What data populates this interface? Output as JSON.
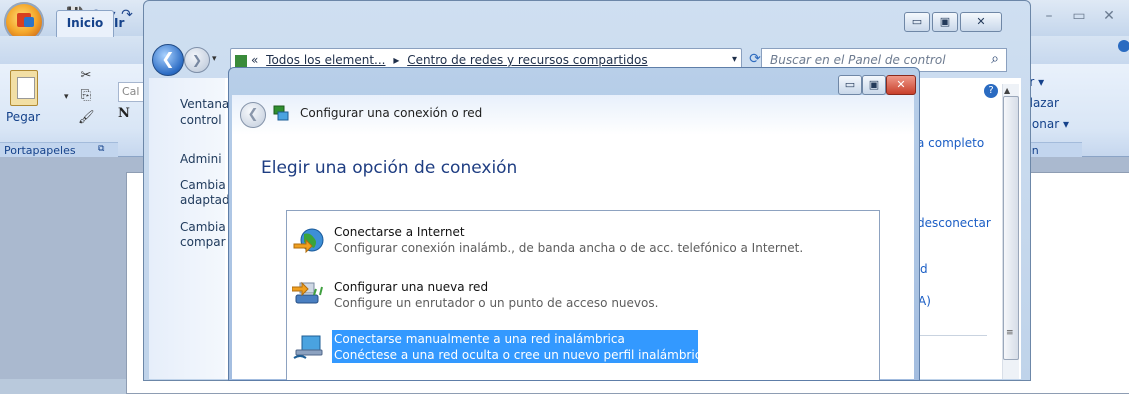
{
  "word": {
    "tabs": [
      "Inicio",
      "Ir"
    ],
    "clipboard": {
      "paste_label": "Pegar",
      "group_label": "Portapapeles"
    },
    "font_name": "Cal",
    "bold_label": "N",
    "right_ribbon_items": [
      "ar ▾",
      "plazar",
      "cionar ▾"
    ],
    "right_group_label": "ión",
    "controls": {
      "minimize": "–",
      "restore": "▭",
      "close": "✕"
    }
  },
  "control_panel": {
    "breadcrumb": [
      "«",
      "Todos los element...",
      "▸",
      "Centro de redes y recursos compartidos"
    ],
    "search_placeholder": "Buscar en el Panel de control",
    "left_links": [
      "Ventana",
      "control",
      "Admini",
      "Cambia",
      "adaptad",
      "Cambia",
      "compar"
    ],
    "right_links": [
      "a completo",
      "desconectar",
      "d",
      "A)"
    ],
    "controls": {
      "minimize": "▭",
      "restore": "▣",
      "close": "✕"
    }
  },
  "dialog": {
    "title": "Configurar una conexión o red",
    "heading": "Elegir una opción de conexión",
    "controls": {
      "minimize": "▭",
      "restore": "▣",
      "close": "✕"
    },
    "options": [
      {
        "title": "Conectarse a Internet",
        "description": "Configurar conexión inalámb., de banda ancha o de acc. telefónico a Internet.",
        "icon": "globe-icon",
        "selected": false
      },
      {
        "title": "Configurar una nueva red",
        "description": "Configure un enrutador o un punto de acceso nuevos.",
        "icon": "router-icon",
        "selected": false
      },
      {
        "title": "Conectarse manualmente a una red inalámbrica",
        "description": "Conéctese a una red oculta o cree un nuevo perfil inalámbrico.",
        "icon": "wireless-network-icon",
        "selected": true
      }
    ]
  },
  "colors": {
    "selection": "#3399ff",
    "heading": "#1e3d82",
    "link": "#1b5ec5"
  }
}
